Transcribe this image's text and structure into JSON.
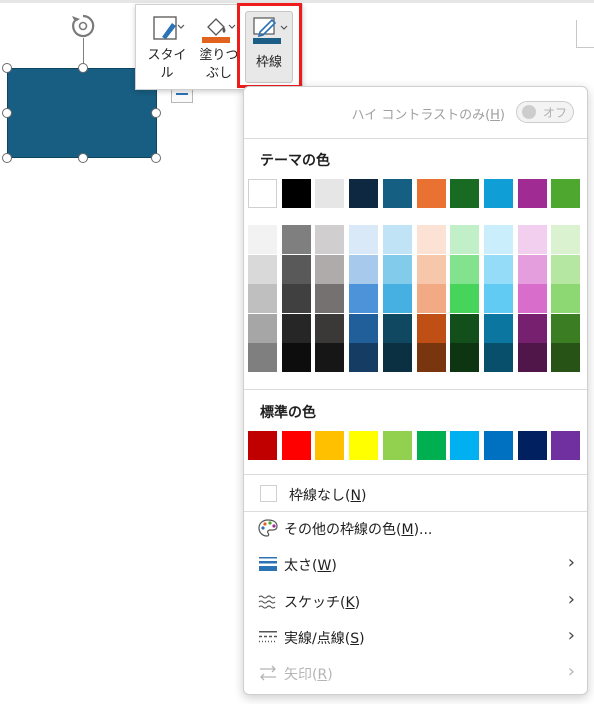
{
  "toolbar": {
    "style_label_1": "スタイ",
    "style_label_2": "ル",
    "fill_label_1": "塗りつ",
    "fill_label_2": "ぶし",
    "border_label": "枠線",
    "colors": {
      "fill_bar": "#e2631f",
      "border_bar": "#1d5e86",
      "pen": "#2c73b5"
    }
  },
  "menu": {
    "high_contrast": {
      "label": "ハイ コントラストのみ(",
      "key": "H",
      "suffix": ")",
      "toggle_text": "オフ"
    },
    "theme_colors_title": "テーマの色",
    "theme_colors": [
      "#ffffff",
      "#000000",
      "#e7e6e6",
      "#0e2841",
      "#156082",
      "#e97132",
      "#196b24",
      "#0f9ed5",
      "#a02b93",
      "#4ea72e"
    ],
    "theme_shades": [
      [
        "#f2f2f2",
        "#d9d9d9",
        "#bfbfbf",
        "#a6a6a6",
        "#7f7f7f"
      ],
      [
        "#7f7f7f",
        "#595959",
        "#404040",
        "#262626",
        "#0d0d0d"
      ],
      [
        "#d0cece",
        "#afabab",
        "#767171",
        "#3b3838",
        "#171616"
      ],
      [
        "#dae9f8",
        "#a6c9ec",
        "#4d93d9",
        "#215f9a",
        "#153d64"
      ],
      [
        "#c0e4f5",
        "#83cbeb",
        "#45b0e1",
        "#104862",
        "#0b3041"
      ],
      [
        "#fbe2d5",
        "#f7c7ac",
        "#f2aa84",
        "#c04f15",
        "#78350e"
      ],
      [
        "#c1f0c8",
        "#83e28e",
        "#47d45a",
        "#124f1a",
        "#0d3512"
      ],
      [
        "#caeefb",
        "#94dcf8",
        "#61cbf3",
        "#0b76a0",
        "#074f6a"
      ],
      [
        "#f2cfee",
        "#e59edd",
        "#d86dcb",
        "#782070",
        "#501549"
      ],
      [
        "#daf2d0",
        "#b5e6a2",
        "#8ed873",
        "#3b7d23",
        "#275317"
      ]
    ],
    "standard_colors_title": "標準の色",
    "standard_colors": [
      "#c00000",
      "#ff0000",
      "#ffc000",
      "#ffff00",
      "#92d050",
      "#00b050",
      "#00b0f0",
      "#0070c0",
      "#002060",
      "#7030a0"
    ],
    "no_border": {
      "label": "枠線なし(",
      "key": "N",
      "suffix": ")"
    },
    "more_colors": {
      "label": "その他の枠線の色(",
      "key": "M",
      "suffix": ")..."
    },
    "weight": {
      "label": "太さ(",
      "key": "W",
      "suffix": ")"
    },
    "sketch": {
      "label": "スケッチ(",
      "key": "K",
      "suffix": ")"
    },
    "dashes": {
      "label": "実線/点線(",
      "key": "S",
      "suffix": ")"
    },
    "arrows": {
      "label": "矢印(",
      "key": "R",
      "suffix": ")"
    }
  },
  "shape": {
    "fill": "#175e82"
  }
}
